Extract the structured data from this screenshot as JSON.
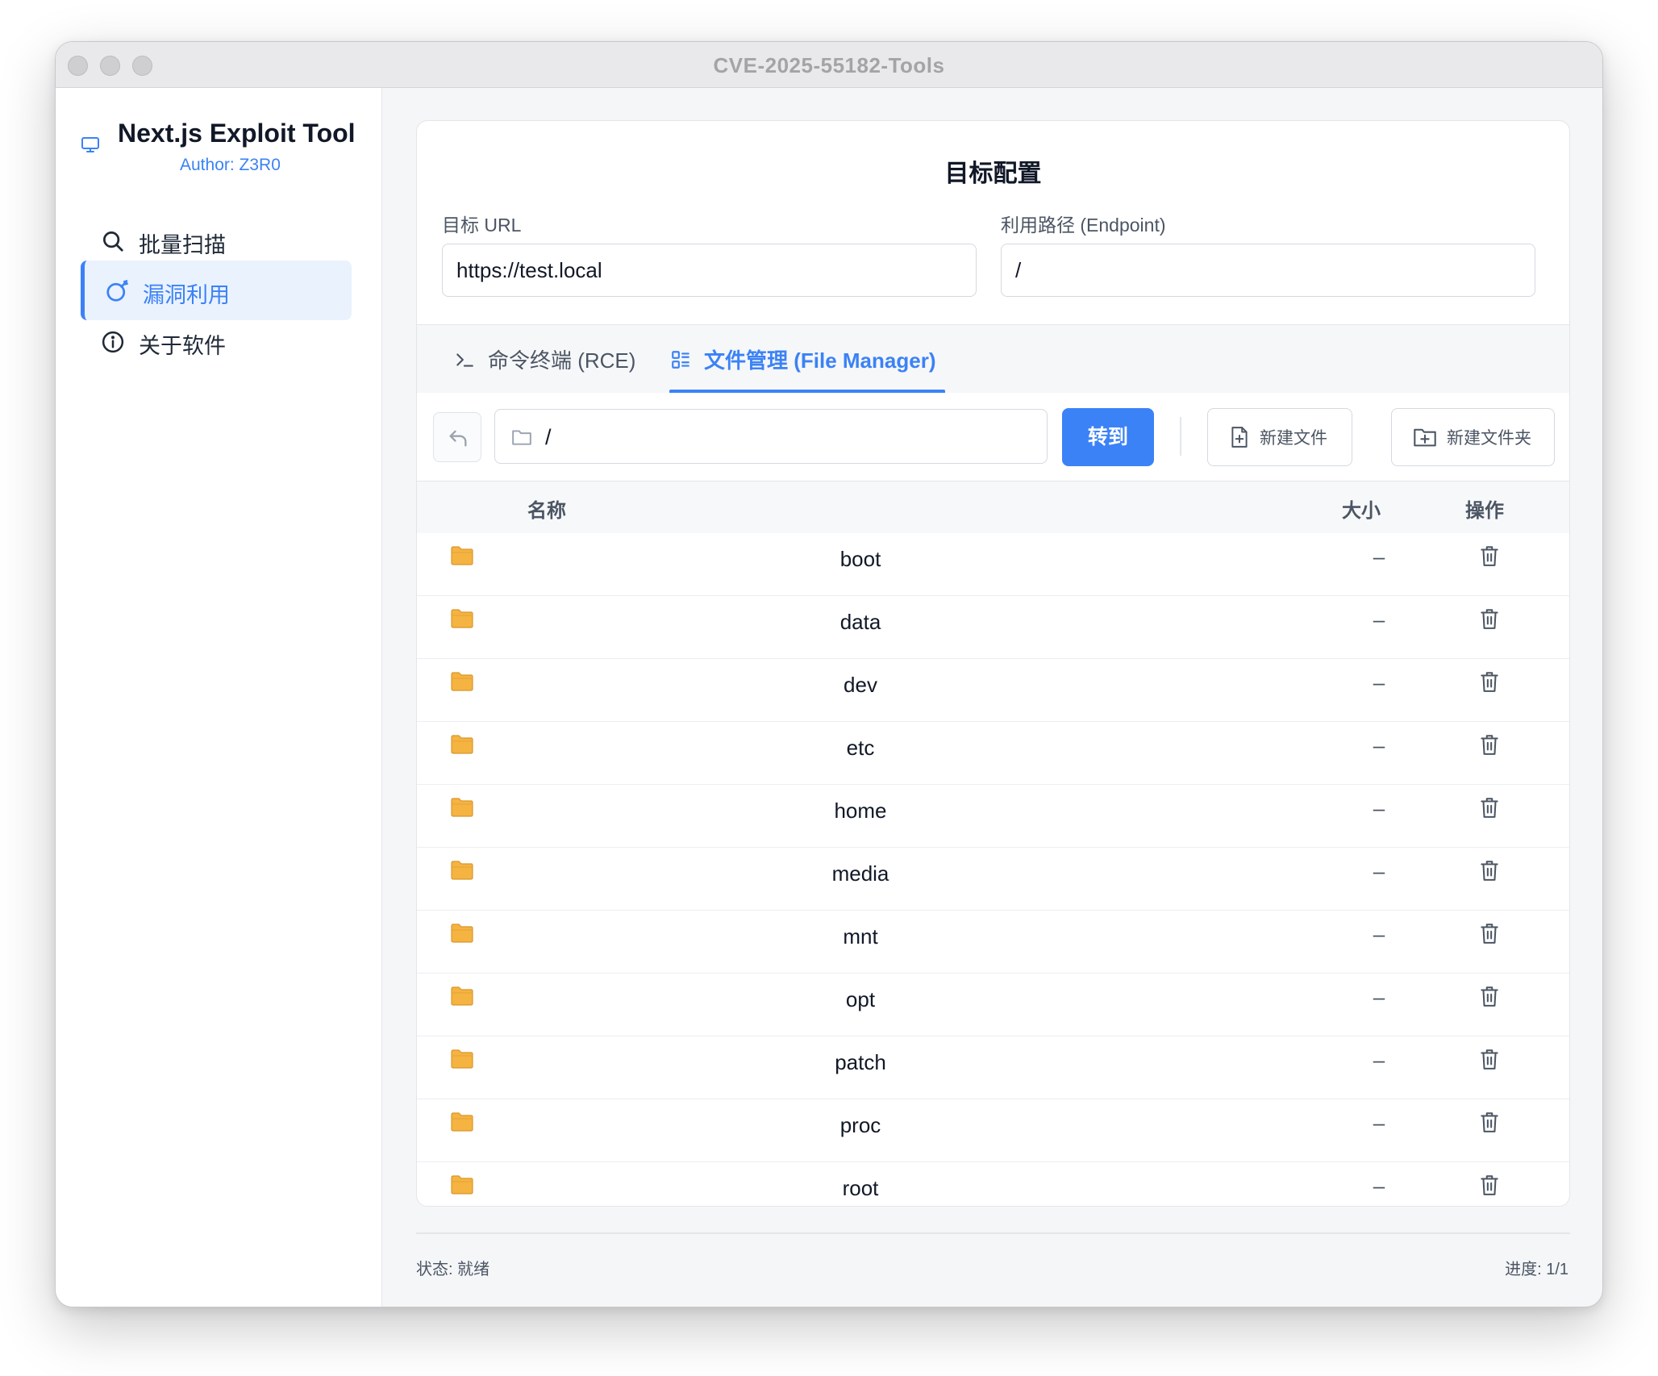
{
  "window": {
    "title": "CVE-2025-55182-Tools"
  },
  "sidebar": {
    "brand": {
      "title": "Next.js Exploit Tool",
      "author": "Author: Z3R0",
      "icon": "monitor-icon"
    },
    "items": [
      {
        "label": "批量扫描",
        "icon": "search-icon",
        "active": false
      },
      {
        "label": "漏洞利用",
        "icon": "bomb-icon",
        "active": true
      },
      {
        "label": "关于软件",
        "icon": "info-icon",
        "active": false
      }
    ]
  },
  "config": {
    "title": "目标配置",
    "url": {
      "label": "目标 URL",
      "value": "https://test.local"
    },
    "endpoint": {
      "label": "利用路径 (Endpoint)",
      "value": "/"
    }
  },
  "tabs": [
    {
      "label": "命令终端 (RCE)",
      "icon": "terminal-icon",
      "active": false
    },
    {
      "label": "文件管理 (File Manager)",
      "icon": "file-list-icon",
      "active": true
    }
  ],
  "toolbar": {
    "path": "/",
    "go_label": "转到",
    "new_file_label": "新建文件",
    "new_folder_label": "新建文件夹"
  },
  "table": {
    "headers": {
      "name": "名称",
      "size": "大小",
      "actions": "操作"
    },
    "rows": [
      {
        "name": "boot",
        "size": "–"
      },
      {
        "name": "data",
        "size": "–"
      },
      {
        "name": "dev",
        "size": "–"
      },
      {
        "name": "etc",
        "size": "–"
      },
      {
        "name": "home",
        "size": "–"
      },
      {
        "name": "media",
        "size": "–"
      },
      {
        "name": "mnt",
        "size": "–"
      },
      {
        "name": "opt",
        "size": "–"
      },
      {
        "name": "patch",
        "size": "–"
      },
      {
        "name": "proc",
        "size": "–"
      },
      {
        "name": "root",
        "size": "–"
      }
    ]
  },
  "status": {
    "left": "状态: 就绪",
    "right": "进度: 1/1"
  },
  "colors": {
    "accent": "#3b82f6",
    "folder": "#f5b342",
    "sidebar_active_bg": "#eaf2fe"
  }
}
